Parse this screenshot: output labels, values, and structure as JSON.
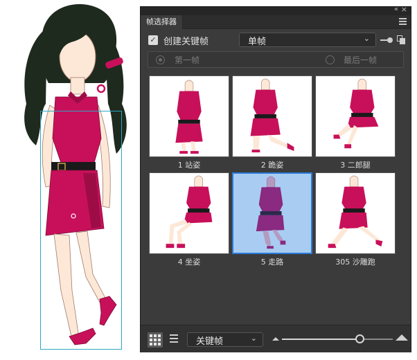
{
  "panel": {
    "tab_title": "帧选择器",
    "collapse_glyph": "«",
    "close_glyph": "×"
  },
  "options": {
    "create_keyframe_label": "创建关键帧",
    "create_keyframe_checked": true,
    "check_glyph": "✓",
    "mode_value": "单帧",
    "chevron_glyph": "⌄"
  },
  "range": {
    "first_label": "第一帧",
    "last_label": "最后一帧"
  },
  "frames": [
    {
      "caption": "1 站姿",
      "pose": "stand",
      "selected": false
    },
    {
      "caption": "2 跪姿",
      "pose": "kneel",
      "selected": false
    },
    {
      "caption": "3 二郎腿",
      "pose": "crosslegs",
      "selected": false
    },
    {
      "caption": "4 坐姿",
      "pose": "sit",
      "selected": false
    },
    {
      "caption": "5 走路",
      "pose": "walk",
      "selected": true
    },
    {
      "caption": "305 沙雕跑",
      "pose": "run",
      "selected": false
    }
  ],
  "bottom": {
    "filter_value": "关键帧",
    "zoom_level": 0.7
  },
  "colors": {
    "dress": "#c8105a",
    "dress_shade": "#9e0c46",
    "skin": "#fde8d8",
    "hair": "#1e2a1e",
    "belt": "#1a1a1a",
    "selection_box": "#2ba6c4",
    "selected_thumb": "#a9cdf2"
  }
}
